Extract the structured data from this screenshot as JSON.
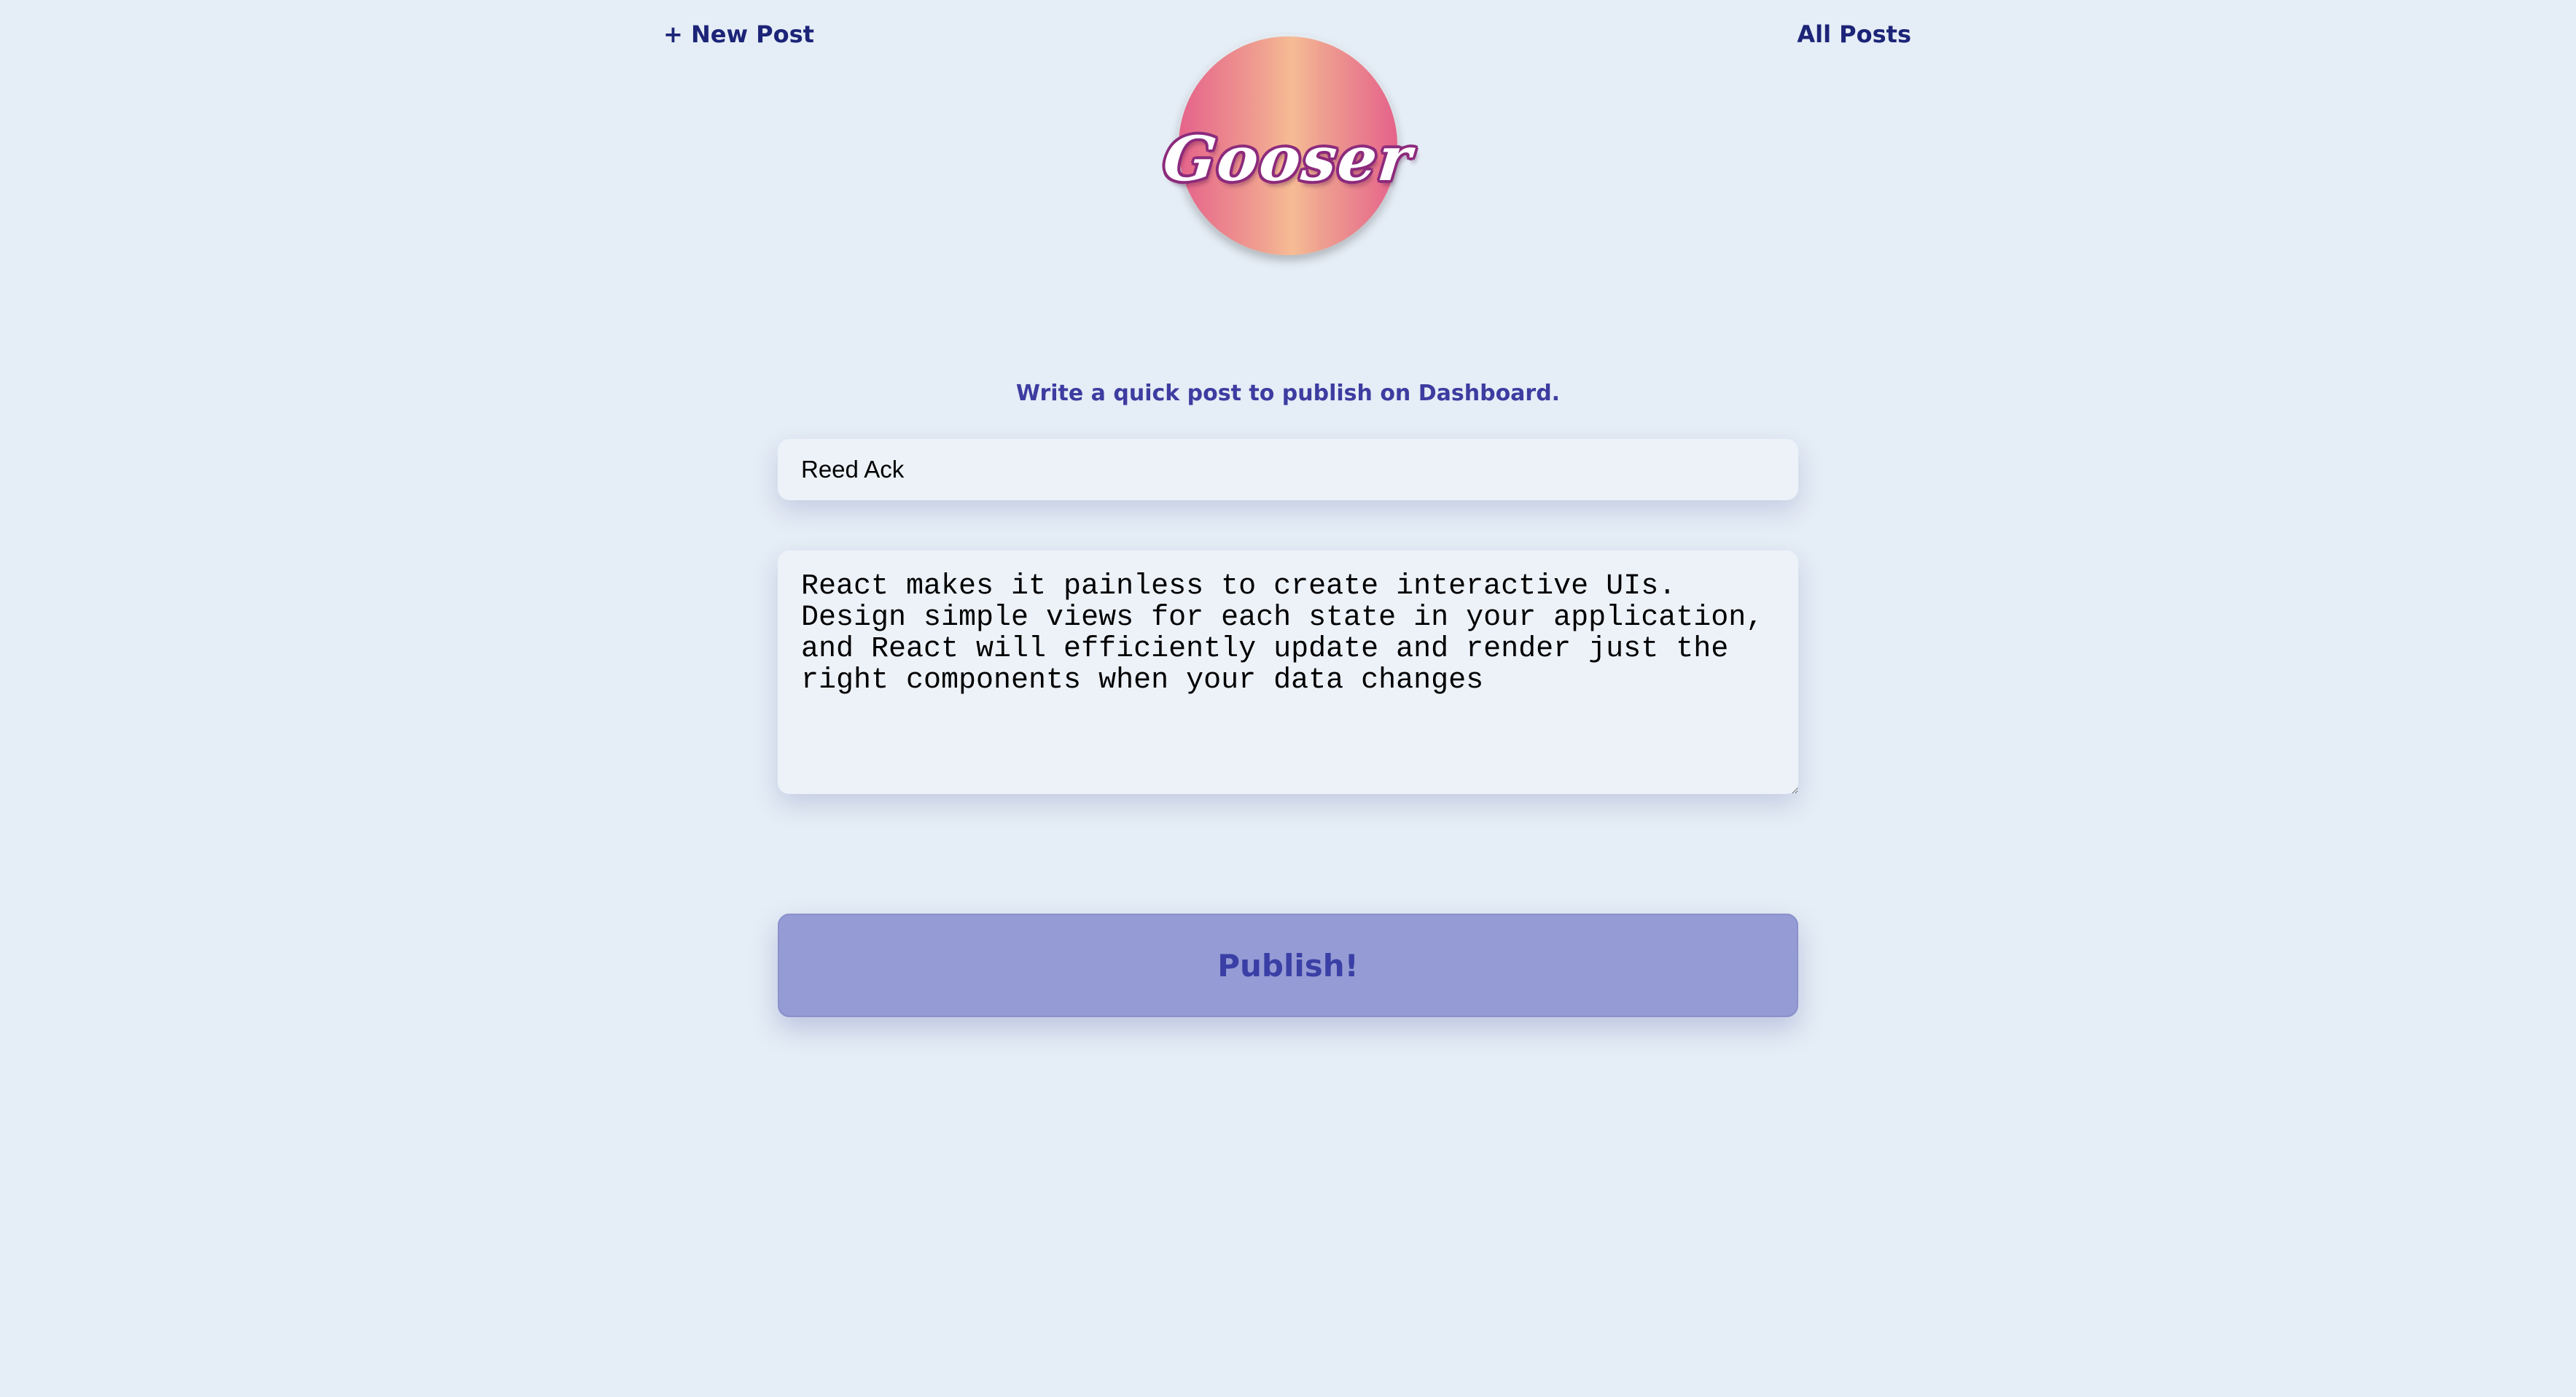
{
  "nav": {
    "new_post": "+ New Post",
    "all_posts": "All Posts"
  },
  "logo": {
    "text": "Gooser"
  },
  "form": {
    "subtitle": "Write a quick post to publish on Dashboard.",
    "author_value": "Reed Ack",
    "body_value": "React makes it painless to create interactive UIs. Design simple views for each state in your application, and React will efficiently update and render just the right components when your data changes",
    "publish_label": "Publish!"
  },
  "colors": {
    "background": "#e5edf6",
    "nav_text": "#1c2478",
    "accent": "#3d3ca0",
    "button_bg": "#959bd4"
  }
}
